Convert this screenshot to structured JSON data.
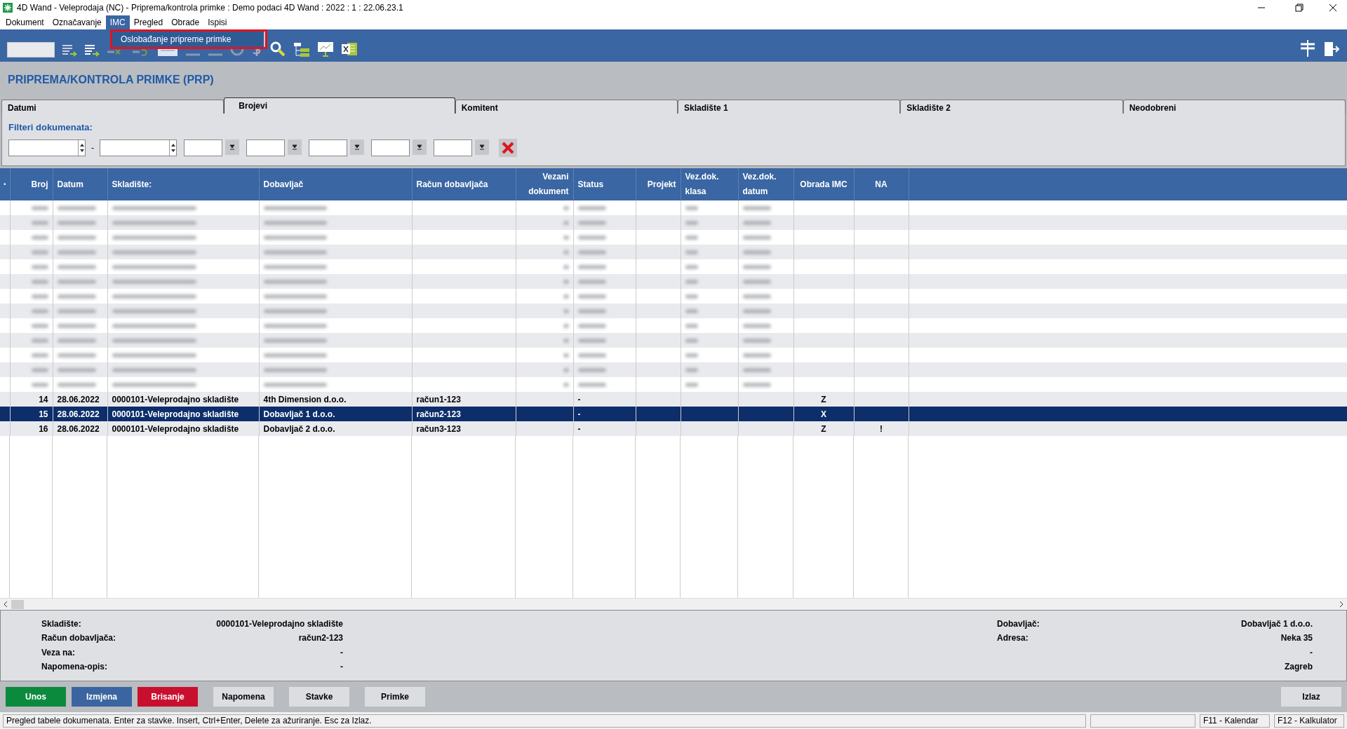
{
  "window": {
    "title": "4D Wand - Veleprodaja (NC) - Priprema/kontrola primke : Demo podaci 4D Wand : 2022 : 1 : 22.06.23.1"
  },
  "menu": [
    {
      "label": "Dokument",
      "selected": false
    },
    {
      "label": "Označavanje",
      "selected": false
    },
    {
      "label": "IMC",
      "selected": true
    },
    {
      "label": "Pregled",
      "selected": false
    },
    {
      "label": "Obrade",
      "selected": false
    },
    {
      "label": "Ispisi",
      "selected": false
    }
  ],
  "dropdown": {
    "items": [
      {
        "label": "Oslobađanje pripreme primke",
        "selected": true
      }
    ]
  },
  "page_title": "PRIPREMA/KONTROLA PRIMKE (PRP)",
  "tabs": [
    {
      "label": "Datumi",
      "selected": false
    },
    {
      "label": "Brojevi",
      "selected": true
    },
    {
      "label": "Komitent",
      "selected": false
    },
    {
      "label": "Skladište 1",
      "selected": false
    },
    {
      "label": "Skladište 2",
      "selected": false
    },
    {
      "label": "Neodobreni",
      "selected": false
    }
  ],
  "filters": {
    "title": "Filteri dokumenata:",
    "separator": "-"
  },
  "table": {
    "columns": [
      "•",
      "Broj",
      "Datum",
      "Skladište:",
      "Dobavljač",
      "Račun dobavljača",
      "Vezani dokument",
      "Status",
      "Projekt",
      "Vez.dok. klasa",
      "Vez.dok. datum",
      "Obrada IMC",
      "NA"
    ],
    "blurred_rows": [
      {
        "kind": "blurred"
      },
      {
        "kind": "blurred"
      },
      {
        "kind": "blurred"
      },
      {
        "kind": "blurred"
      },
      {
        "kind": "blurred"
      },
      {
        "kind": "blurred"
      },
      {
        "kind": "blurred"
      },
      {
        "kind": "blurred"
      },
      {
        "kind": "blurred"
      },
      {
        "kind": "blurred"
      },
      {
        "kind": "blurred"
      },
      {
        "kind": "blurred"
      },
      {
        "kind": "blurred"
      }
    ],
    "rows": [
      {
        "broj": "14",
        "datum": "28.06.2022",
        "skladiste": "0000101-Veleprodajno skladište",
        "dobavljac": "4th Dimension d.o.o.",
        "racun": "račun1-123",
        "status": "-",
        "obrada_imc": "Z",
        "selected": false
      },
      {
        "broj": "15",
        "datum": "28.06.2022",
        "skladiste": "0000101-Veleprodajno skladište",
        "dobavljac": "Dobavljač 1 d.o.o.",
        "racun": "račun2-123",
        "status": "-",
        "obrada_imc": "X",
        "selected": true
      },
      {
        "broj": "16",
        "datum": "28.06.2022",
        "skladiste": "0000101-Veleprodajno skladište",
        "dobavljac": "Dobavljač 2  d.o.o.",
        "racun": "račun3-123",
        "status": "-",
        "obrada_imc": "Z",
        "na": "!",
        "selected": false
      }
    ]
  },
  "details": {
    "left": [
      {
        "label": "Skladište:",
        "value": "0000101-Veleprodajno skladište"
      },
      {
        "label": "Račun dobavljača:",
        "value": "račun2-123"
      },
      {
        "label": "Veza na:",
        "value": "-"
      },
      {
        "label": "Napomena-opis:",
        "value": "-"
      }
    ],
    "right": [
      {
        "label": "Dobavljač:",
        "value": "Dobavljač 1 d.o.o."
      },
      {
        "label": "Adresa:",
        "value": "Neka 35"
      },
      {
        "value": "-"
      },
      {
        "value": "Zagreb"
      }
    ]
  },
  "buttons": [
    {
      "label": "Unos",
      "kind": "green"
    },
    {
      "label": "Izmjena",
      "kind": "blue"
    },
    {
      "label": "Brisanje",
      "kind": "red"
    },
    {
      "label": "Napomena",
      "kind": "plain"
    },
    {
      "label": "Stavke",
      "kind": "plain"
    },
    {
      "label": "Primke",
      "kind": "plain"
    }
  ],
  "exit_button": "Izlaz",
  "status_bar": {
    "text": "Pregled tabele dokumenata. Enter za stavke. Insert, Ctrl+Enter, Delete za ažuriranje. Esc za Izlaz.",
    "keys": [
      "F11 - Kalendar",
      "F12 - Kalkulator"
    ]
  }
}
